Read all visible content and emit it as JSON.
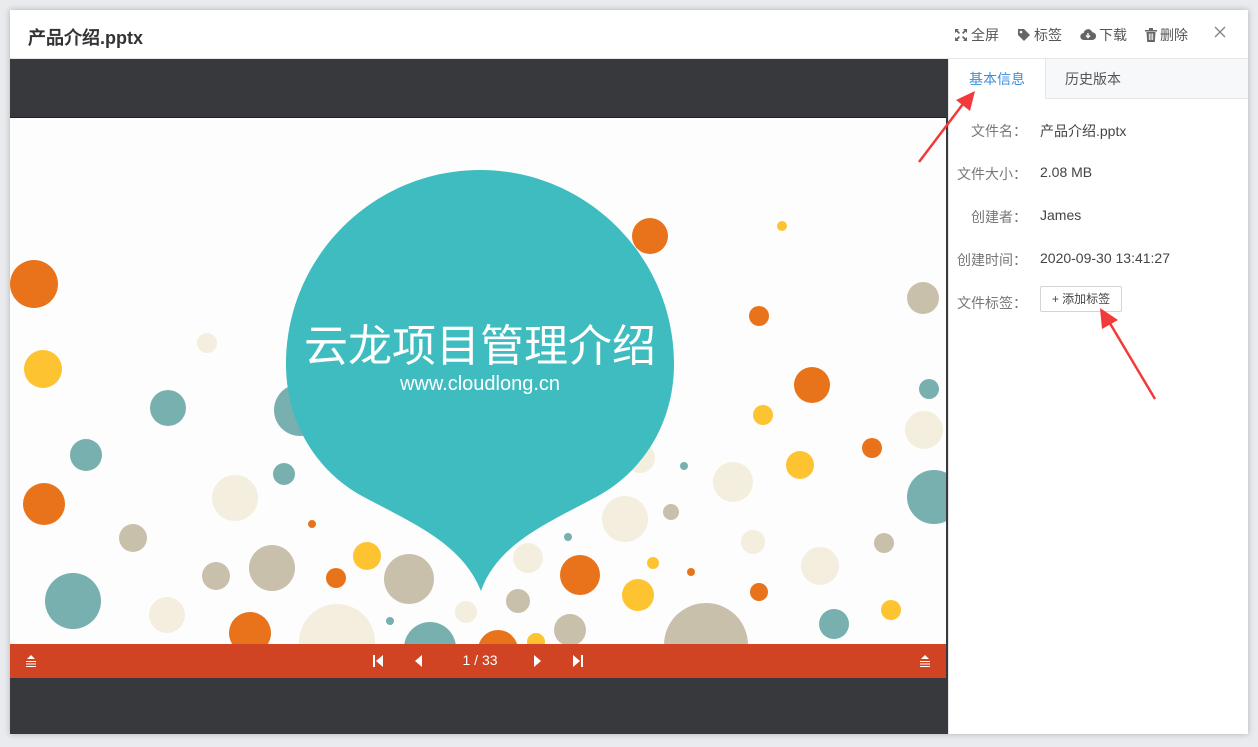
{
  "dialog": {
    "title": "产品介绍.pptx",
    "actions": [
      {
        "label": "全屏",
        "icon": "expand-icon"
      },
      {
        "label": "标签",
        "icon": "tag-icon"
      },
      {
        "label": "下载",
        "icon": "cloud-download-icon"
      },
      {
        "label": "删除",
        "icon": "trash-icon"
      }
    ],
    "close_icon": "close-icon"
  },
  "slide": {
    "title": "云龙项目管理介绍",
    "subtitle": "www.cloudlong.cn",
    "colors": {
      "teal": "#3fbcc0",
      "orange": "#e8731a",
      "yellow": "#fdc331",
      "beige": "#c8c0ab",
      "bar": "#d04424"
    }
  },
  "pager": {
    "current": "1",
    "total": "33",
    "text": "1 / 33"
  },
  "sidebar": {
    "tabs": [
      {
        "label": "基本信息",
        "active": true
      },
      {
        "label": "历史版本",
        "active": false
      }
    ],
    "fields": [
      {
        "label": "文件名：",
        "value": "产品介绍.pptx"
      },
      {
        "label": "文件大小：",
        "value": "2.08 MB"
      },
      {
        "label": "创建者：",
        "value": "James"
      },
      {
        "label": "创建时间：",
        "value": "2020-09-30 13:41:27"
      },
      {
        "label": "文件标签：",
        "value": ""
      }
    ],
    "add_tag_label": "+ 添加标签"
  }
}
